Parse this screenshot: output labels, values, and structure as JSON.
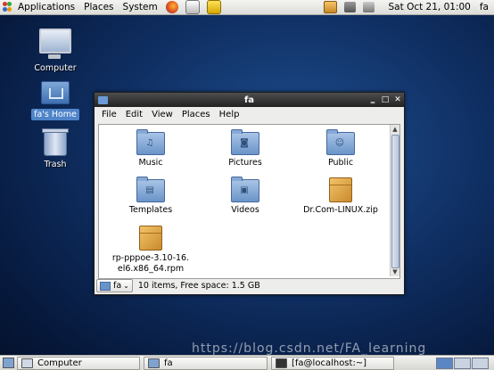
{
  "top_panel": {
    "menus": [
      "Applications",
      "Places",
      "System"
    ],
    "clock": "Sat Oct 21, 01:00",
    "user": "fa"
  },
  "desktop": {
    "icons": [
      {
        "label": "Computer"
      },
      {
        "label": "fa's Home"
      },
      {
        "label": "Trash"
      }
    ]
  },
  "window": {
    "title": "fa",
    "menu": [
      "File",
      "Edit",
      "View",
      "Places",
      "Help"
    ],
    "items": [
      {
        "label": "Music",
        "type": "folder",
        "glyph": "♫"
      },
      {
        "label": "Pictures",
        "type": "folder",
        "glyph": "◙"
      },
      {
        "label": "Public",
        "type": "folder",
        "glyph": "☺"
      },
      {
        "label": "Templates",
        "type": "folder",
        "glyph": "▤"
      },
      {
        "label": "Videos",
        "type": "folder",
        "glyph": "▣"
      },
      {
        "label": "Dr.Com-LINUX.zip",
        "type": "archive"
      },
      {
        "label": "rp-pppoe-3.10-16.\nel6.x86_64.rpm",
        "type": "package"
      }
    ],
    "status": {
      "place": "fa",
      "text": "10 items, Free space: 1.5 GB"
    }
  },
  "bottom_panel": {
    "tasks": [
      "Computer",
      "fa",
      "[fa@localhost:~]"
    ]
  },
  "watermark": "https://blog.csdn.net/FA_learning",
  "colors": {
    "desktop": "#0f2f63",
    "selection": "#4f84c9",
    "folder": "#6a94c9"
  }
}
